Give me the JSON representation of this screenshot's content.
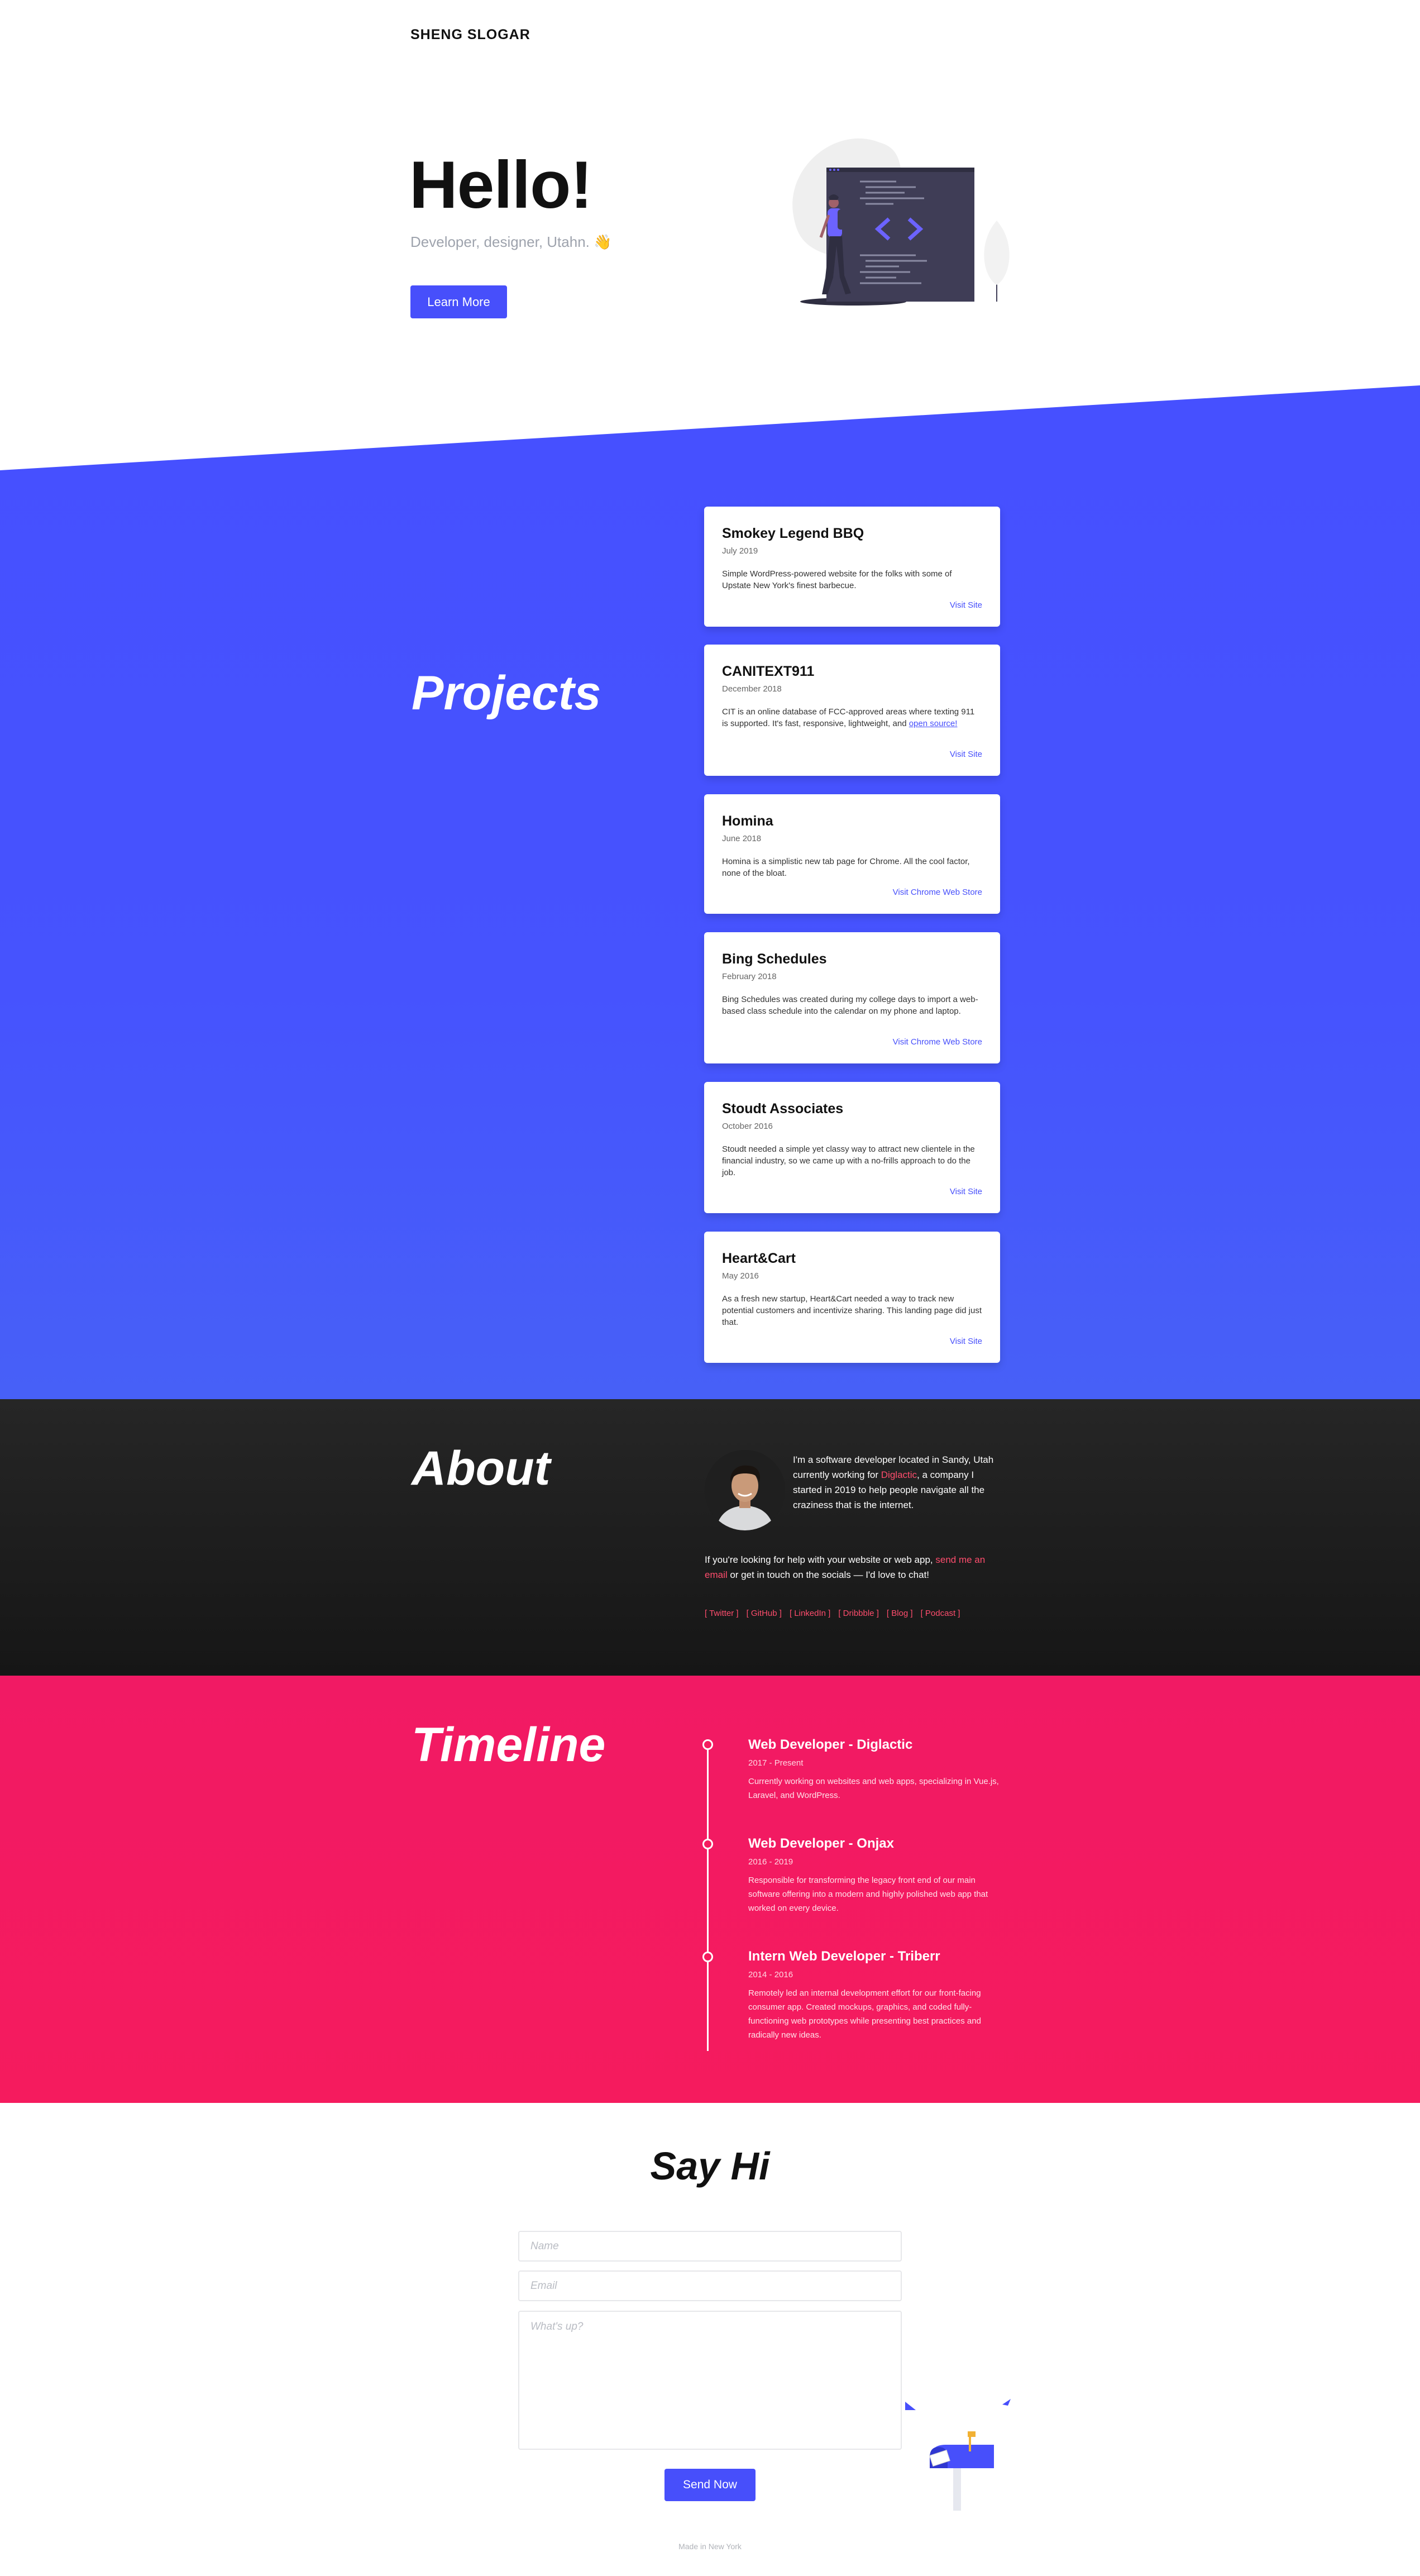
{
  "brand": "SHENG SLOGAR",
  "hero": {
    "title": "Hello!",
    "subtitle": "Developer, designer, Utahn. 👋",
    "button": "Learn More"
  },
  "projects": {
    "title": "Projects",
    "items": [
      {
        "name": "Smokey Legend BBQ",
        "date": "July 2019",
        "description": "Simple WordPress-powered website for the folks with some of Upstate New York's finest barbecue.",
        "link": "Visit Site"
      },
      {
        "name": "CANITEXT911",
        "date": "December 2018",
        "description": "CIT is an online database of FCC-approved areas where texting 911 is supported. It's fast, responsive, lightweight, and",
        "description_link": "open source!",
        "link": "Visit Site"
      },
      {
        "name": "Homina",
        "date": "June 2018",
        "description": "Homina is a simplistic new tab page for Chrome. All the cool factor, none of the bloat.",
        "link": "Visit Chrome Web Store"
      },
      {
        "name": "Bing Schedules",
        "date": "February 2018",
        "description": "Bing Schedules was created during my college days to import a web-based class schedule into the calendar on my phone and laptop.",
        "link": "Visit Chrome Web Store"
      },
      {
        "name": "Stoudt Associates",
        "date": "October 2016",
        "description": "Stoudt needed a simple yet classy way to attract new clientele in the financial industry, so we came up with a no-frills approach to do the job.",
        "link": "Visit Site"
      },
      {
        "name": "Heart&Cart",
        "date": "May 2016",
        "description": "As a fresh new startup, Heart&Cart needed a way to track new potential customers and incentivize sharing. This landing page did just that.",
        "link": "Visit Site"
      }
    ]
  },
  "about": {
    "title": "About",
    "p1_a": "I'm a software developer located in Sandy, Utah currently working for ",
    "p1_link": "Diglactic",
    "p1_b": ", a company I started in 2019 to help people navigate all the craziness that is the internet.",
    "p2_a": "If you're looking for help with your website or web app, ",
    "p2_link": "send me an email",
    "p2_b": " or get in touch on the socials — I'd love to chat!",
    "socials": [
      "[ Twitter ]",
      "[ GitHub ]",
      "[ LinkedIn ]",
      "[ Dribbble ]",
      "[ Blog ]",
      "[ Podcast ]"
    ]
  },
  "timeline": {
    "title": "Timeline",
    "items": [
      {
        "role": "Web Developer - Diglactic",
        "years": "2017 - Present",
        "description": "Currently working on websites and web apps, specializing in Vue.js, Laravel, and WordPress."
      },
      {
        "role": "Web Developer - Onjax",
        "years": "2016 - 2019",
        "description": "Responsible for transforming the legacy front end of our main software offering into a modern and highly polished web app that worked on every device."
      },
      {
        "role": "Intern Web Developer - Triberr",
        "years": "2014 - 2016",
        "description": "Remotely led an internal development effort for our front-facing consumer app. Created mockups, graphics, and coded fully-functioning web prototypes while presenting best practices and radically new ideas."
      }
    ]
  },
  "contact": {
    "title": "Say Hi",
    "name_placeholder": "Name",
    "email_placeholder": "Email",
    "message_placeholder": "What's up?",
    "button": "Send Now"
  },
  "footer": "Made in New York",
  "colors": {
    "accent": "#474ffb",
    "pink": "#f31b62",
    "dark": "#1e1e1e"
  }
}
